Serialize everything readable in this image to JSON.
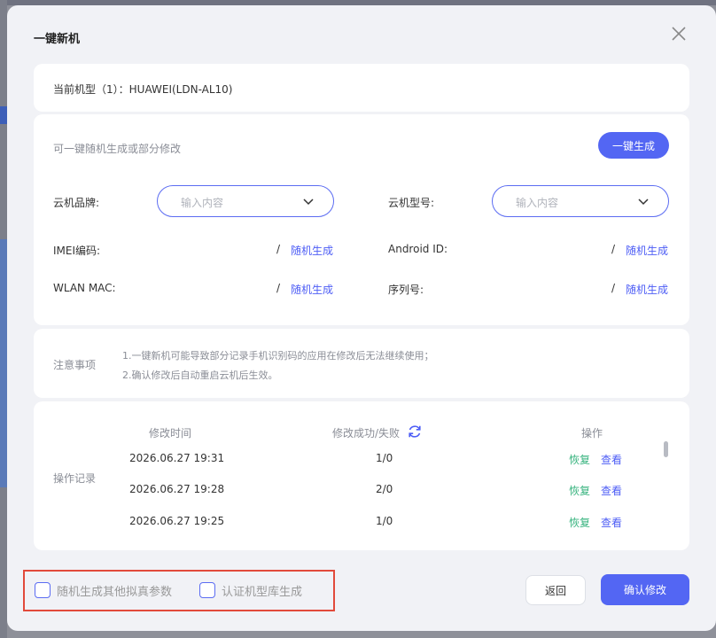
{
  "dialog": {
    "title": "一键新机",
    "close_icon": "close-icon"
  },
  "current_model": "当前机型（1）：HUAWEI(LDN-AL10)",
  "generate": {
    "hint": "可一键随机生成或部分修改",
    "button_label": "一键生成",
    "brand_label": "云机品牌:",
    "brand_placeholder": "输入内容",
    "model_label": "云机型号:",
    "model_placeholder": "输入内容",
    "imei_label": "IMEI编码:",
    "imei_value": "/",
    "imei_action": "随机生成",
    "android_id_label": "Android ID:",
    "android_id_value": "/",
    "android_id_action": "随机生成",
    "wlan_label": "WLAN MAC:",
    "wlan_value": "/",
    "wlan_action": "随机生成",
    "serial_label": "序列号:",
    "serial_value": "/",
    "serial_action": "随机生成"
  },
  "notice": {
    "label": "注意事项",
    "line1": "1.一键新机可能导致部分记录手机识别码的应用在修改后无法继续使用；",
    "line2": "2.确认修改后自动重启云机后生效。"
  },
  "records": {
    "label": "操作记录",
    "col_time": "修改时间",
    "col_result": "修改成功/失败",
    "col_action": "操作",
    "rows": [
      {
        "time": "2026.06.27 19:31",
        "result": "1/0",
        "restore": "恢复",
        "view": "查看"
      },
      {
        "time": "2026.06.27 19:28",
        "result": "2/0",
        "restore": "恢复",
        "view": "查看"
      },
      {
        "time": "2026.06.27 19:25",
        "result": "1/0",
        "restore": "恢复",
        "view": "查看"
      }
    ]
  },
  "footer": {
    "checkbox1_label": "随机生成其他拟真参数",
    "checkbox2_label": "认证机型库生成",
    "back_label": "返回",
    "confirm_label": "确认修改"
  },
  "colors": {
    "accent": "#5366f3",
    "link": "#4d5df5",
    "restore": "#36b37e",
    "highlight_box": "#e24a3b"
  }
}
